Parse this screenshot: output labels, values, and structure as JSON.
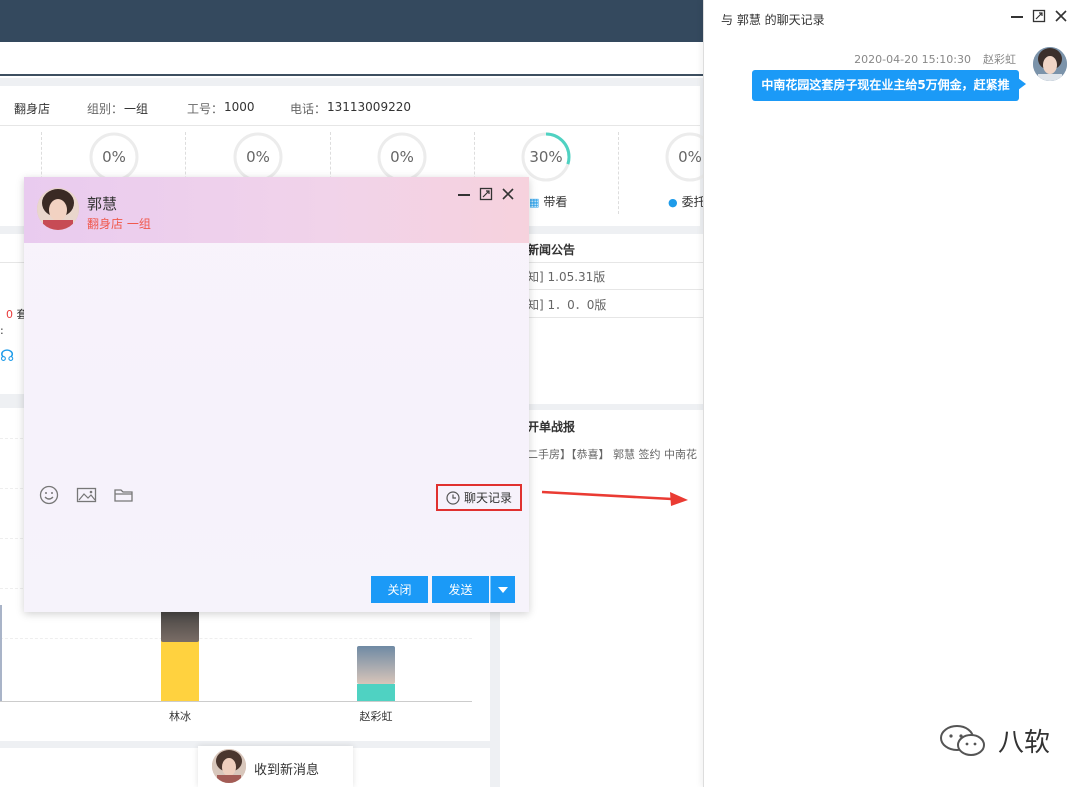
{
  "info": {
    "store_value": "翻身店",
    "group_key": "组别：",
    "group_value": "一组",
    "id_key": "工号：",
    "id_value": "1000",
    "phone_key": "电话：",
    "phone_value": "13113009220"
  },
  "gauges": [
    {
      "text": "0%",
      "progress": 0
    },
    {
      "text": "0%",
      "progress": 0
    },
    {
      "text": "0%",
      "progress": 0
    },
    {
      "text": "30%",
      "progress": 0.3
    },
    {
      "text": "0%",
      "progress": 0
    }
  ],
  "gauge_labels": {
    "view": "带看",
    "entrust": "委托"
  },
  "left_panel": {
    "count_value": "0",
    "count_suffix": "套",
    "colon": ":"
  },
  "news": {
    "title": "新闻公告",
    "items": [
      "知] 1.05.31版",
      "知] 1．0．0版"
    ]
  },
  "battle": {
    "title": "开单战报",
    "item": "二手房】【恭喜】 郭慧 签约 中南花"
  },
  "chart_data": {
    "type": "bar",
    "categories": [
      "",
      "林冰",
      "赵彩虹"
    ],
    "colors": [
      "#a9b4c8",
      "#ffd23f",
      "#4fd2c2"
    ]
  },
  "chat": {
    "name": "郭慧",
    "sub": "翻身店 一组",
    "history_label": "聊天记录",
    "close_label": "关闭",
    "send_label": "发送"
  },
  "notify": {
    "text": "收到新消息"
  },
  "history": {
    "title": "与 郭慧 的聊天记录",
    "time": "2020-04-20 15:10:30",
    "sender": "赵彩虹",
    "message": "中南花园这套房子现在业主给5万佣金，赶紧推"
  },
  "watermark": {
    "text": "八软"
  },
  "colors": {
    "accent": "#1b9af7",
    "header_dark": "#34495e",
    "gauge_ring": "#4fd2c2",
    "highlight_red": "#e0312f"
  }
}
